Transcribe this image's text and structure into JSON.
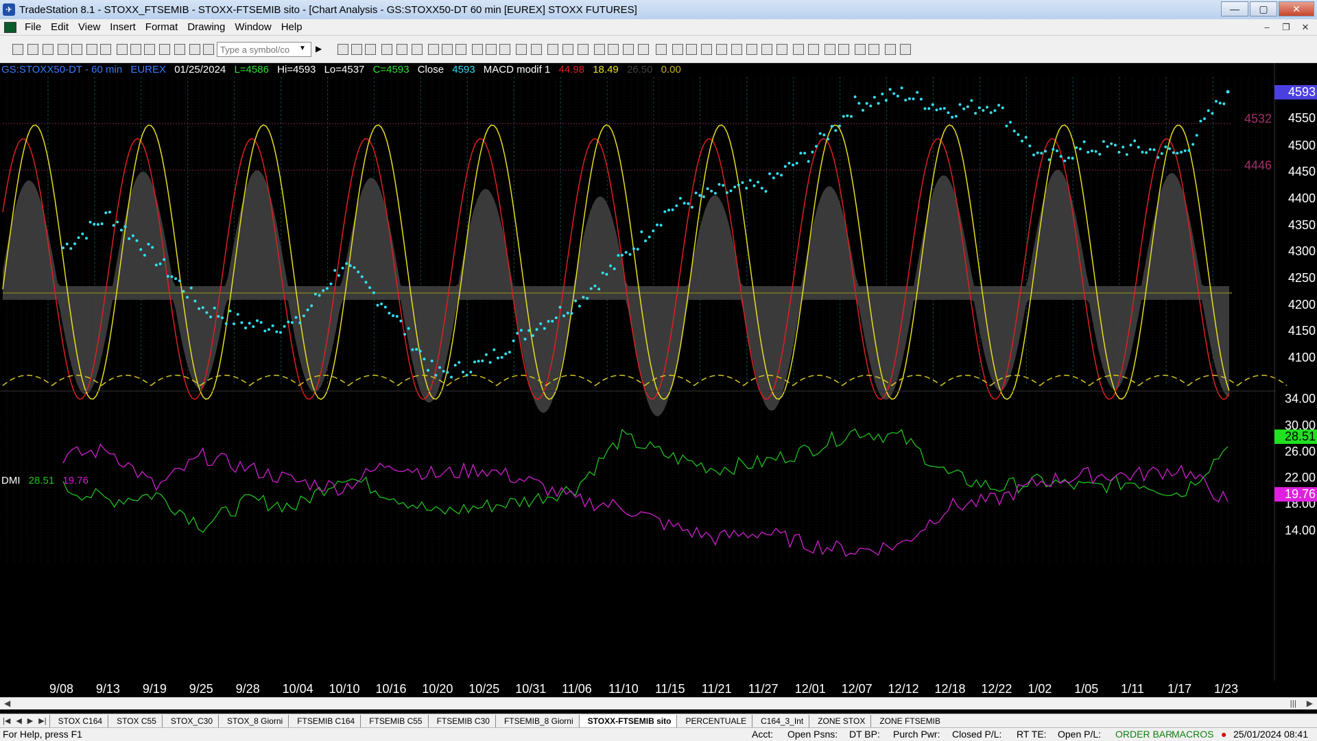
{
  "window": {
    "title": "TradeStation 8.1 - STOXX_FTSEMIB - STOXX-FTSEMIB sito - [Chart Analysis - GS:STOXX50-DT  60 min  [EUREX] STOXX FUTURES]",
    "minimize": "—",
    "maximize": "▢",
    "close": "✕"
  },
  "menu": {
    "items": [
      "File",
      "Edit",
      "View",
      "Insert",
      "Format",
      "Drawing",
      "Window",
      "Help"
    ]
  },
  "toolbar": {
    "symbol_placeholder": "Type a symbol/co"
  },
  "chart": {
    "header": {
      "symbol": "GS:STOXX50-DT - 60 min",
      "exchange": "EUREX",
      "date": "01/25/2024",
      "last": "L=4586",
      "high": "Hi=4593",
      "low": "Lo=4537",
      "close_eq": "C=4593",
      "close_label": "Close",
      "close_value": "4593",
      "macd_label": "MACD modif 1",
      "macd_v1": "44.98",
      "macd_v2": "18.49",
      "macd_v3": "26.50",
      "macd_v4": "0.00"
    },
    "dmi": {
      "label": "DMI",
      "plus": "28.51",
      "minus": "19.76"
    },
    "price_axis": [
      "4600",
      "4550",
      "4500",
      "4450",
      "4400",
      "4350",
      "4300",
      "4250",
      "4200",
      "4150",
      "4100"
    ],
    "price_last_badge": "4593",
    "hline_labels": [
      "4532",
      "4446"
    ],
    "dmi_axis": [
      "34.00",
      "30.00",
      "26.00",
      "22.00",
      "18.00",
      "14.00"
    ],
    "dmi_plus_badge": "28.51",
    "dmi_minus_badge": "19.76",
    "x_axis": [
      "9/08",
      "9/13",
      "9/19",
      "9/25",
      "9/28",
      "10/04",
      "10/10",
      "10/16",
      "10/20",
      "10/25",
      "10/31",
      "11/06",
      "11/10",
      "11/15",
      "11/21",
      "11/27",
      "12/01",
      "12/07",
      "12/12",
      "12/18",
      "12/22",
      "1/02",
      "1/05",
      "1/11",
      "1/17",
      "1/23"
    ],
    "colors": {
      "price": "#33e0f0",
      "macd_red": "#e02020",
      "macd_yellow": "#e8e020",
      "dmi_plus": "#20c020",
      "dmi_minus": "#d020d0",
      "band": "#404040"
    }
  },
  "chart_data": {
    "type": "line",
    "title": "GS:STOXX50-DT - 60 min",
    "x": [
      "9/08",
      "9/13",
      "9/19",
      "9/25",
      "9/28",
      "10/04",
      "10/10",
      "10/16",
      "10/20",
      "10/25",
      "10/31",
      "11/06",
      "11/10",
      "11/15",
      "11/21",
      "11/27",
      "12/01",
      "12/07",
      "12/12",
      "12/18",
      "12/22",
      "1/02",
      "1/05",
      "1/11",
      "1/17",
      "1/23"
    ],
    "ylim": [
      4060,
      4620
    ],
    "series": [
      {
        "name": "Close",
        "values": [
          4310,
          4370,
          4290,
          4200,
          4170,
          4170,
          4280,
          4200,
          4080,
          4100,
          4160,
          4210,
          4290,
          4380,
          4410,
          4420,
          4480,
          4570,
          4590,
          4560,
          4570,
          4470,
          4490,
          4490,
          4480,
          4593
        ]
      }
    ],
    "dmi": {
      "ylim": [
        11,
        36
      ],
      "series": [
        {
          "name": "DMI+",
          "values": [
            22,
            20,
            21,
            16,
            20,
            19,
            24,
            21,
            18,
            19,
            20,
            22,
            30,
            27,
            25,
            26,
            28,
            31,
            30,
            24,
            22,
            23,
            22,
            23,
            21,
            28.51
          ]
        },
        {
          "name": "DMI-",
          "values": [
            27,
            28,
            22,
            27,
            25,
            23,
            22,
            26,
            24,
            25,
            23,
            20,
            19,
            16,
            14,
            15,
            13,
            12,
            13,
            19,
            20,
            23,
            24,
            24,
            25,
            19.76
          ]
        }
      ]
    }
  },
  "tabs": [
    "STOX C164",
    "STOX C55",
    "STOX_C30",
    "STOX_8 Giorni",
    "FTSEMIB C164",
    "FTSEMIB C55",
    "FTSEMIB C30",
    "FTSEMIB_8 Giorni",
    "STOXX-FTSEMIB sito",
    "PERCENTUALE",
    "C164_3_Int",
    "ZONE STOX",
    "ZONE FTSEMIB"
  ],
  "active_tab": "STOXX-FTSEMIB sito",
  "status": {
    "help": "For Help, press F1",
    "acct": "Acct:",
    "open_psns": "Open Psns:",
    "dt_bp": "DT BP:",
    "purch_pwr": "Purch Pwr:",
    "closed_pl": "Closed P/L:",
    "rt_te": "RT TE:",
    "open_pl": "Open P/L:",
    "order_bar": "ORDER BAR",
    "macros": "MACROS",
    "datetime": "25/01/2024 08:41"
  }
}
